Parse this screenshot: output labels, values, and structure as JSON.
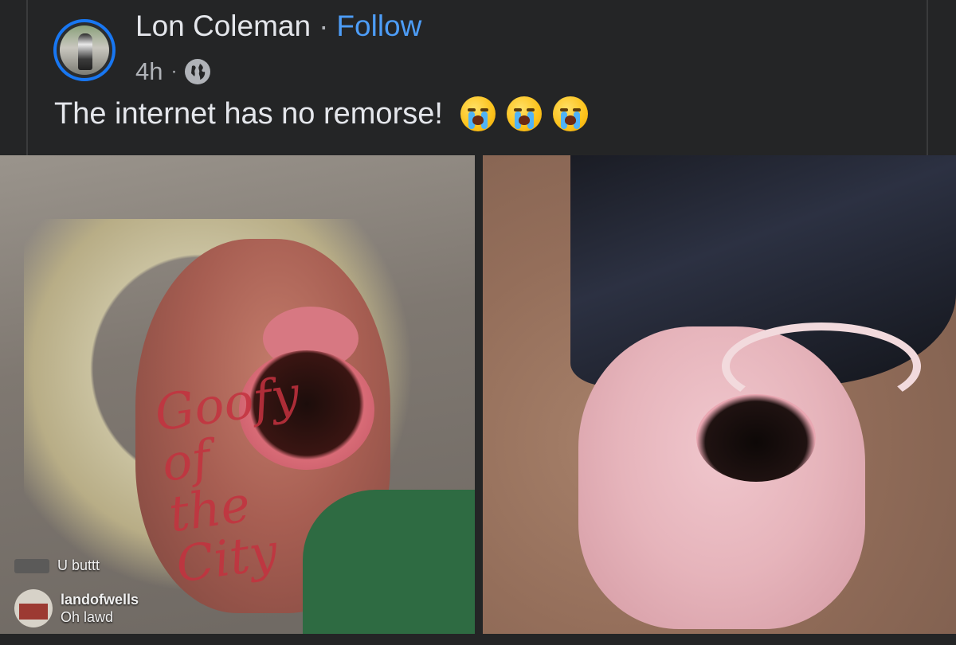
{
  "post": {
    "author": "Lon Coleman",
    "separator": "·",
    "follow_label": "Follow",
    "time": "4h",
    "meta_separator": "·",
    "privacy_icon": "globe-icon",
    "text": "The internet has no remorse!",
    "emojis": [
      "loudly-crying-face",
      "loudly-crying-face",
      "loudly-crying-face"
    ]
  },
  "left_image": {
    "tattoo_text": "Goofy of the City",
    "comments": [
      {
        "user": "",
        "text": "U buttt"
      },
      {
        "user": "landofwells",
        "text": "Oh lawd"
      }
    ]
  },
  "colors": {
    "background": "#242526",
    "accent": "#4d9df7",
    "avatar_ring": "#1877f2",
    "text_primary": "#e4e6eb",
    "text_secondary": "#b0b3b8"
  }
}
